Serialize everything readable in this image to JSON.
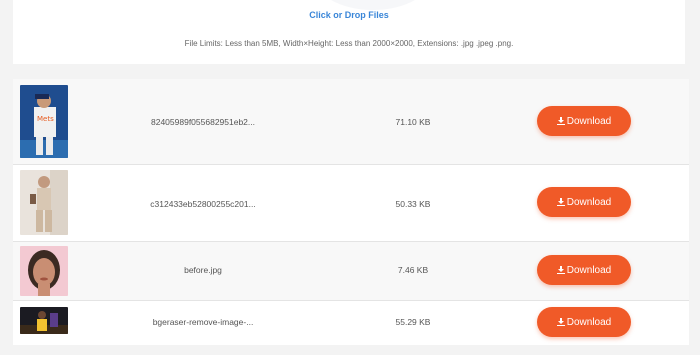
{
  "upload": {
    "drop_label": "Click or Drop Files",
    "limits_text": "File Limits: Less than 5MB, Width×Height: Less than 2000×2000, Extensions: .jpg .jpeg .png."
  },
  "files": [
    {
      "name": "82405989f055682951eb2...",
      "size": "71.10 KB",
      "button": "Download",
      "thumb_icon": "baseball-player-photo"
    },
    {
      "name": "c312433eb52800255c201...",
      "size": "50.33 KB",
      "button": "Download",
      "thumb_icon": "fashion-model-photo"
    },
    {
      "name": "before.jpg",
      "size": "7.46 KB",
      "button": "Download",
      "thumb_icon": "portrait-photo"
    },
    {
      "name": "bgeraser-remove-image-...",
      "size": "55.29 KB",
      "button": "Download",
      "thumb_icon": "basketball-player-photo"
    }
  ],
  "colors": {
    "accent": "#f05a28",
    "link": "#3a86d8"
  }
}
